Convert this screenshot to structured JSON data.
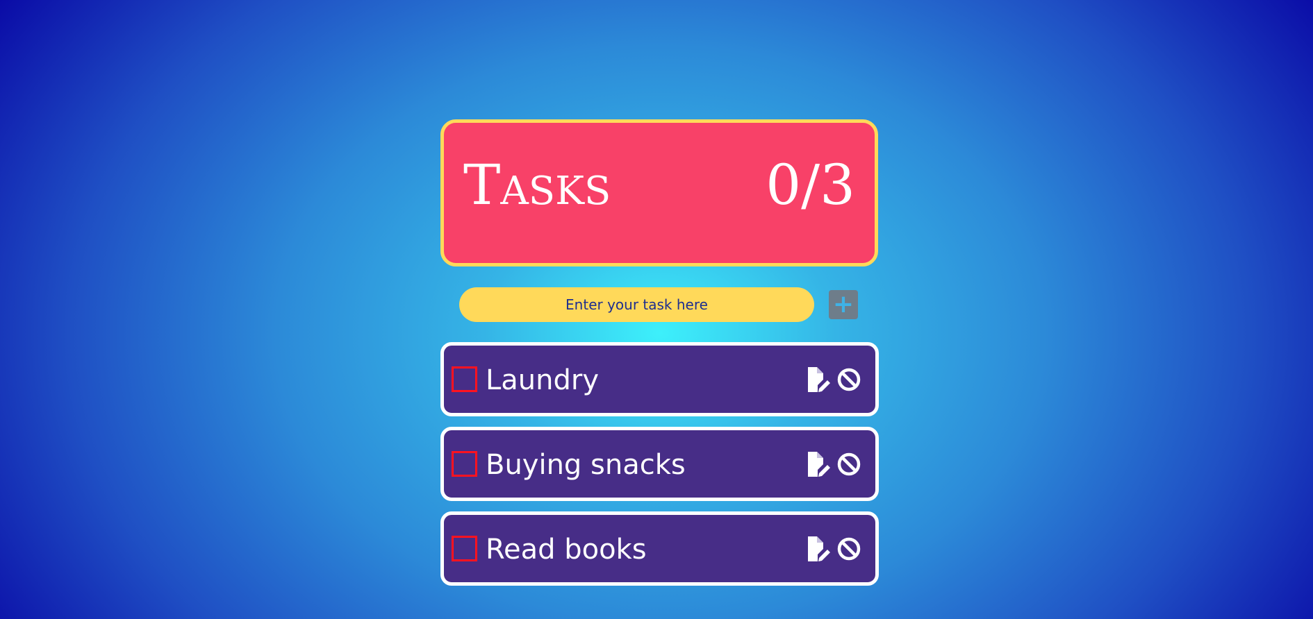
{
  "header": {
    "title": "Tasks",
    "count": "0/3"
  },
  "input": {
    "placeholder": "Enter your task here"
  },
  "add_button": {
    "label": "+"
  },
  "tasks": [
    {
      "label": "Laundry",
      "checked": false
    },
    {
      "label": "Buying snacks",
      "checked": false
    },
    {
      "label": "Read books",
      "checked": false
    }
  ],
  "icons": {
    "edit": "file-edit-icon",
    "delete": "ban-icon"
  },
  "colors": {
    "header_bg": "#f84168",
    "header_border": "#ffd95a",
    "input_bg": "#ffd95a",
    "task_bg": "#472d87",
    "checkbox_border": "#ff1320"
  }
}
